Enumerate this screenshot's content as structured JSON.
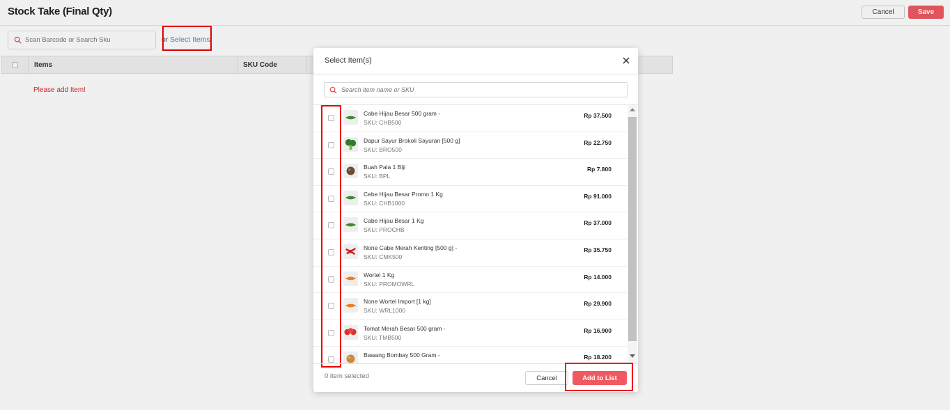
{
  "page": {
    "title": "Stock Take (Final Qty)",
    "cancel_label": "Cancel",
    "save_label": "Save",
    "scan_placeholder": "Scan Barcode or Search Sku",
    "or_text": "or",
    "select_items_link": "Select Items",
    "table_headers": [
      "Items",
      "SKU Code"
    ],
    "empty_message": "Please add Item!"
  },
  "modal": {
    "title": "Select Item(s)",
    "search_placeholder": "Search item name or SKU",
    "selected_count": "0 item selected",
    "cancel_label": "Cancel",
    "add_label": "Add to List",
    "items": [
      {
        "name": "Cabe Hijau Besar 500 gram -",
        "sku": "SKU: CHB500",
        "price": "Rp 37.500",
        "icon": "green-chili-icon",
        "color": "#3d8a2e"
      },
      {
        "name": "Dapur Sayur Brokoli Sayuran [500 g]",
        "sku": "SKU: BRO500",
        "price": "Rp 22.750",
        "icon": "broccoli-icon",
        "color": "#2f7d2a"
      },
      {
        "name": "Buah Pala 1 Biji",
        "sku": "SKU: BPL",
        "price": "Rp 7.800",
        "icon": "nutmeg-icon",
        "color": "#6b4a2f"
      },
      {
        "name": "Cebe Hijau Besar Promo 1 Kg",
        "sku": "SKU: CHB1000",
        "price": "Rp 91.000",
        "icon": "green-chili-icon",
        "color": "#3d8a2e"
      },
      {
        "name": "Cabe Hijau Besar 1 Kg",
        "sku": "SKU: PROCHB",
        "price": "Rp 37.000",
        "icon": "green-chili-icon",
        "color": "#3d8a2e"
      },
      {
        "name": "None Cabe Merah Keriting [500 g] -",
        "sku": "SKU: CMK500",
        "price": "Rp 35.750",
        "icon": "red-chili-icon",
        "color": "#c9231f"
      },
      {
        "name": "Wortel 1 Kg",
        "sku": "SKU: PROMOWRL",
        "price": "Rp 14.000",
        "icon": "carrot-icon",
        "color": "#ef7a1a"
      },
      {
        "name": "None Wortel Import [1 kg]",
        "sku": "SKU: WRL1000",
        "price": "Rp 29.900",
        "icon": "carrot-icon",
        "color": "#ef7a1a"
      },
      {
        "name": "Tomat Merah Besar 500 gram -",
        "sku": "SKU: TMB500",
        "price": "Rp 16.900",
        "icon": "tomato-icon",
        "color": "#d8302b"
      },
      {
        "name": "Bawang Bombay 500 Gram -",
        "sku": "",
        "price": "Rp 18.200",
        "icon": "onion-icon",
        "color": "#c98a3a"
      }
    ]
  },
  "colors": {
    "accent": "#ef5a62",
    "link": "#3b8fd6",
    "error_text": "#d9252c",
    "highlight": "#e00000"
  }
}
